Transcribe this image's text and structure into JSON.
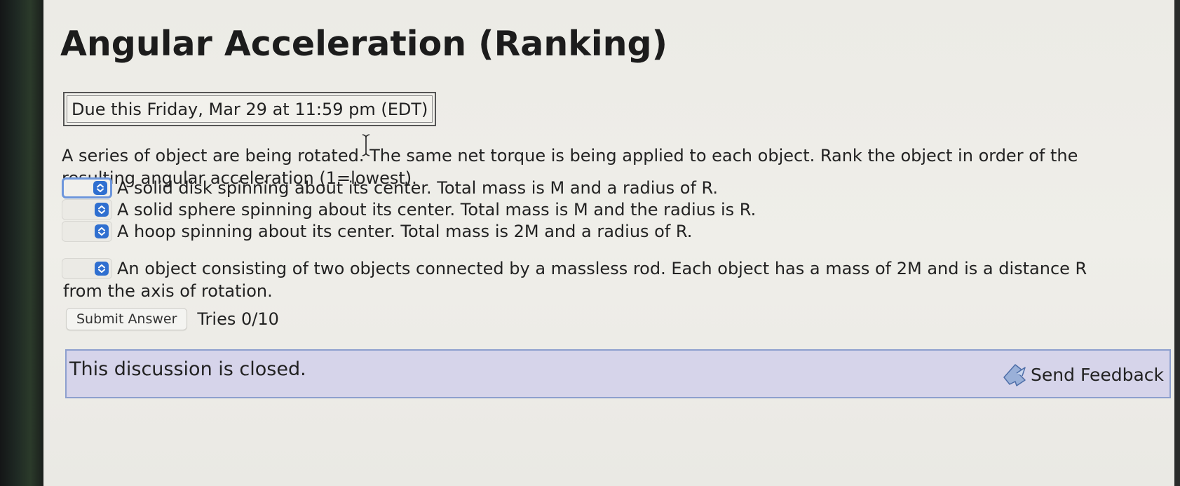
{
  "page": {
    "title": "Angular Acceleration (Ranking)",
    "due": "Due this Friday, Mar 29 at 11:59 pm (EDT)"
  },
  "question": {
    "prompt": "A series of object are being rotated. The same net torque is being applied to each object. Rank the object in order of the resulting angular acceleration (1=lowest).",
    "items": [
      {
        "label": "A solid disk spinning about its center. Total mass is M and a radius of R.",
        "selected": ""
      },
      {
        "label": "A solid sphere spinning about its center. Total mass is M and the radius is R.",
        "selected": ""
      },
      {
        "label": "A hoop spinning about its center. Total mass is 2M and a radius of R.",
        "selected": ""
      },
      {
        "label": "An object consisting of two objects connected by a massless rod. Each object has a mass of 2M and is a distance R",
        "continued": "from the axis of rotation.",
        "selected": ""
      }
    ]
  },
  "actions": {
    "submit_label": "Submit Answer",
    "tries": "Tries 0/10"
  },
  "discussion": {
    "status": "This discussion is closed.",
    "feedback_label": "Send Feedback"
  },
  "colors": {
    "accent": "#2f6fd0",
    "focus_ring": "#6d96dc",
    "discussion_bg": "#d6d4ea",
    "discussion_border": "#8d9fce"
  },
  "icons": {
    "stepper": "up-down-chevron-icon",
    "feedback": "send-feedback-icon",
    "cursor": "text-cursor-icon"
  }
}
